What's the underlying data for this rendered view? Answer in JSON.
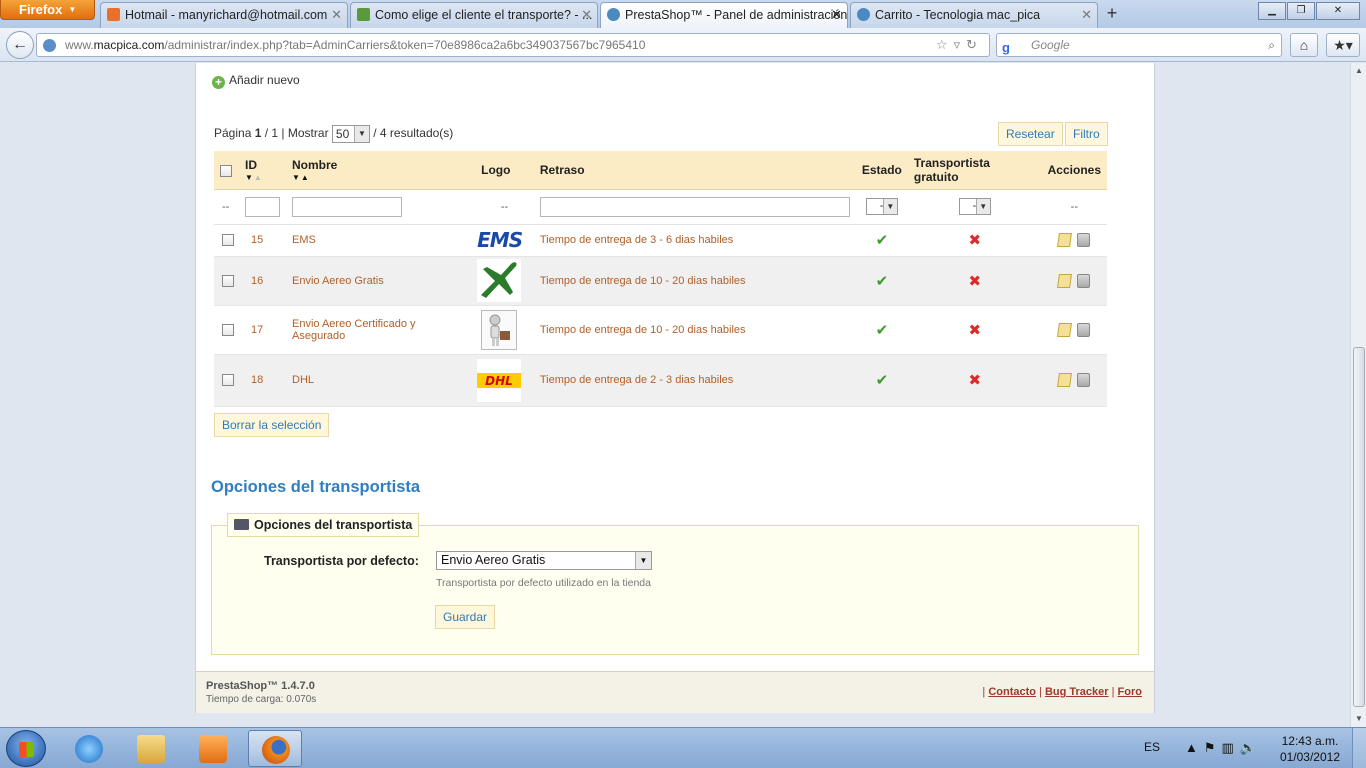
{
  "browser": {
    "menu_label": "Firefox",
    "tabs": [
      {
        "title": "Hotmail - manyrichard@hotmail.com",
        "active": false
      },
      {
        "title": "Como elige el cliente el transporte? - ...",
        "active": false
      },
      {
        "title": "PrestaShop™ - Panel de administración",
        "active": true
      },
      {
        "title": "Carrito - Tecnologia mac_pica",
        "active": false
      }
    ],
    "url_host": "www.macpica.com",
    "url_path": "/administrar/index.php?tab=AdminCarriers&token=70e8986ca2a6bc349037567bc7965410",
    "url_prefix": "www.",
    "url_host_bold": "macpica.com",
    "search_placeholder": "Google"
  },
  "page": {
    "add_new_label": "Añadir nuevo",
    "pager": {
      "page_label": "Página",
      "current_page": "1",
      "total_pages": "/ 1 |",
      "show_label": "Mostrar",
      "per_page": "50",
      "results": "/ 4 resultado(s)"
    },
    "reset_button": "Resetear",
    "filter_button": "Filtro",
    "columns": {
      "id": "ID",
      "name": "Nombre",
      "logo": "Logo",
      "delay": "Retraso",
      "status": "Estado",
      "free": "Transportista gratuito",
      "actions": "Acciones"
    },
    "filter_row": {
      "dash": "--",
      "status_value": "--",
      "free_value": "--",
      "logo_dash": "--",
      "actions_dash": "--"
    },
    "carriers": [
      {
        "id": "15",
        "name": "EMS",
        "logo": "ems-logo",
        "delay": "Tiempo de entrega de 3 - 6 dias habiles",
        "active": true,
        "free": false
      },
      {
        "id": "16",
        "name": "Envio Aereo Gratis",
        "logo": "airplane-logo",
        "delay": "Tiempo de entrega de 10 - 20 dias habiles",
        "active": true,
        "free": false
      },
      {
        "id": "17",
        "name": "Envio Aereo Certificado y Asegurado",
        "logo": "delivery-person-logo",
        "delay": "Tiempo de entrega de 10 - 20 dias habiles",
        "active": true,
        "free": false
      },
      {
        "id": "18",
        "name": "DHL",
        "logo": "dhl-logo",
        "delay": "Tiempo de entrega de 2 - 3 dias habiles",
        "active": true,
        "free": false
      }
    ],
    "ems_text": "EMS",
    "dhl_text": "DHL",
    "delete_selection_button": "Borrar la selección",
    "options_title": "Opciones del transportista",
    "options_legend": "Opciones del transportista",
    "default_carrier_label": "Transportista por defecto:",
    "default_carrier_value": "Envio Aereo Gratis",
    "default_carrier_hint": "Transportista por defecto utilizado en la tienda",
    "save_button": "Guardar",
    "footer": {
      "version": "PrestaShop™ 1.4.7.0",
      "load_time": "Tiempo de carga: 0.070s",
      "contact_link": "Contacto",
      "bugtracker_link": "Bug Tracker",
      "forum_link": "Foro"
    }
  },
  "taskbar": {
    "language": "ES",
    "time": "12:43 a.m.",
    "date": "01/03/2012"
  },
  "colors": {
    "accent_blue": "#2f7fc0",
    "table_header": "#fbecc5",
    "ok_green": "#3f9a2c",
    "no_red": "#dd2a2a",
    "firefox_orange": "#e16e0d"
  }
}
